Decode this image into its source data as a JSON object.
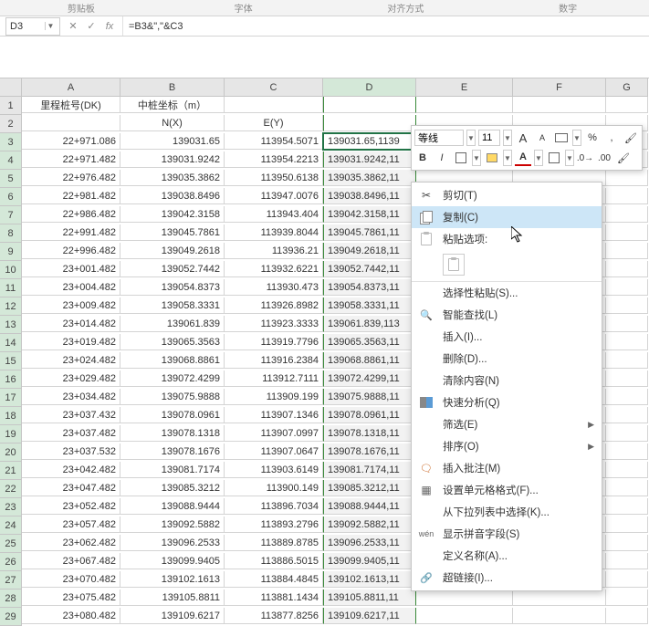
{
  "ribbon_sections": [
    "剪贴板",
    "字体",
    "对齐方式",
    "数字"
  ],
  "name_box": "D3",
  "fx_icons": {
    "cancel": "✕",
    "accept": "✓",
    "fx": "fx"
  },
  "formula": "=B3&\",\"&C3",
  "columns": [
    "A",
    "B",
    "C",
    "D",
    "E",
    "F",
    "G"
  ],
  "header_rows": [
    {
      "n": 1,
      "cells": [
        "里程桩号(DK)",
        "中桩坐标（m）",
        "",
        "",
        "",
        "",
        ""
      ]
    },
    {
      "n": 2,
      "cells": [
        "",
        "N(X)",
        "E(Y)",
        "",
        "",
        "",
        ""
      ]
    }
  ],
  "data_rows": [
    {
      "n": 3,
      "a": "22+971.086",
      "b": "139031.65",
      "c": "113954.5071",
      "d": "139031.65,1139"
    },
    {
      "n": 4,
      "a": "22+971.482",
      "b": "139031.9242",
      "c": "113954.2213",
      "d": "139031.9242,11"
    },
    {
      "n": 5,
      "a": "22+976.482",
      "b": "139035.3862",
      "c": "113950.6138",
      "d": "139035.3862,11"
    },
    {
      "n": 6,
      "a": "22+981.482",
      "b": "139038.8496",
      "c": "113947.0076",
      "d": "139038.8496,11"
    },
    {
      "n": 7,
      "a": "22+986.482",
      "b": "139042.3158",
      "c": "113943.404",
      "d": "139042.3158,11"
    },
    {
      "n": 8,
      "a": "22+991.482",
      "b": "139045.7861",
      "c": "113939.8044",
      "d": "139045.7861,11"
    },
    {
      "n": 9,
      "a": "22+996.482",
      "b": "139049.2618",
      "c": "113936.21",
      "d": "139049.2618,11"
    },
    {
      "n": 10,
      "a": "23+001.482",
      "b": "139052.7442",
      "c": "113932.6221",
      "d": "139052.7442,11"
    },
    {
      "n": 11,
      "a": "23+004.482",
      "b": "139054.8373",
      "c": "113930.473",
      "d": "139054.8373,11"
    },
    {
      "n": 12,
      "a": "23+009.482",
      "b": "139058.3331",
      "c": "113926.8982",
      "d": "139058.3331,11"
    },
    {
      "n": 13,
      "a": "23+014.482",
      "b": "139061.839",
      "c": "113923.3333",
      "d": "139061.839,113"
    },
    {
      "n": 14,
      "a": "23+019.482",
      "b": "139065.3563",
      "c": "113919.7796",
      "d": "139065.3563,11"
    },
    {
      "n": 15,
      "a": "23+024.482",
      "b": "139068.8861",
      "c": "113916.2384",
      "d": "139068.8861,11"
    },
    {
      "n": 16,
      "a": "23+029.482",
      "b": "139072.4299",
      "c": "113912.7111",
      "d": "139072.4299,11"
    },
    {
      "n": 17,
      "a": "23+034.482",
      "b": "139075.9888",
      "c": "113909.199",
      "d": "139075.9888,11"
    },
    {
      "n": 18,
      "a": "23+037.432",
      "b": "139078.0961",
      "c": "113907.1346",
      "d": "139078.0961,11"
    },
    {
      "n": 19,
      "a": "23+037.482",
      "b": "139078.1318",
      "c": "113907.0997",
      "d": "139078.1318,11"
    },
    {
      "n": 20,
      "a": "23+037.532",
      "b": "139078.1676",
      "c": "113907.0647",
      "d": "139078.1676,11"
    },
    {
      "n": 21,
      "a": "23+042.482",
      "b": "139081.7174",
      "c": "113903.6149",
      "d": "139081.7174,11"
    },
    {
      "n": 22,
      "a": "23+047.482",
      "b": "139085.3212",
      "c": "113900.149",
      "d": "139085.3212,11"
    },
    {
      "n": 23,
      "a": "23+052.482",
      "b": "139088.9444",
      "c": "113896.7034",
      "d": "139088.9444,11"
    },
    {
      "n": 24,
      "a": "23+057.482",
      "b": "139092.5882",
      "c": "113893.2796",
      "d": "139092.5882,11"
    },
    {
      "n": 25,
      "a": "23+062.482",
      "b": "139096.2533",
      "c": "113889.8785",
      "d": "139096.2533,11"
    },
    {
      "n": 26,
      "a": "23+067.482",
      "b": "139099.9405",
      "c": "113886.5015",
      "d": "139099.9405,11"
    },
    {
      "n": 27,
      "a": "23+070.482",
      "b": "139102.1613",
      "c": "113884.4845",
      "d": "139102.1613,11"
    },
    {
      "n": 28,
      "a": "23+075.482",
      "b": "139105.8811",
      "c": "113881.1434",
      "d": "139105.8811,11"
    },
    {
      "n": 29,
      "a": "23+080.482",
      "b": "139109.6217",
      "c": "113877.8256",
      "d": "139109.6217,11"
    }
  ],
  "mini_toolbar": {
    "font": "等线",
    "size": "11",
    "a_grow": "A",
    "a_shrink": "A",
    "percent": "%",
    "comma": ",",
    "bold": "B",
    "italic": "I",
    "fontcolor_label": "A"
  },
  "context_menu": {
    "cut": "剪切(T)",
    "copy": "复制(C)",
    "paste_options": "粘贴选项:",
    "paste_special": "选择性粘贴(S)...",
    "smart_lookup": "智能查找(L)",
    "insert": "插入(I)...",
    "delete": "删除(D)...",
    "clear": "清除内容(N)",
    "quick_analysis": "快速分析(Q)",
    "filter": "筛选(E)",
    "sort": "排序(O)",
    "insert_comment": "插入批注(M)",
    "format_cells": "设置单元格格式(F)...",
    "pick_from_list": "从下拉列表中选择(K)...",
    "show_pinyin": "显示拼音字段(S)",
    "define_name": "定义名称(A)...",
    "hyperlink": "超链接(I)..."
  },
  "pinyin_abbr": "wén"
}
